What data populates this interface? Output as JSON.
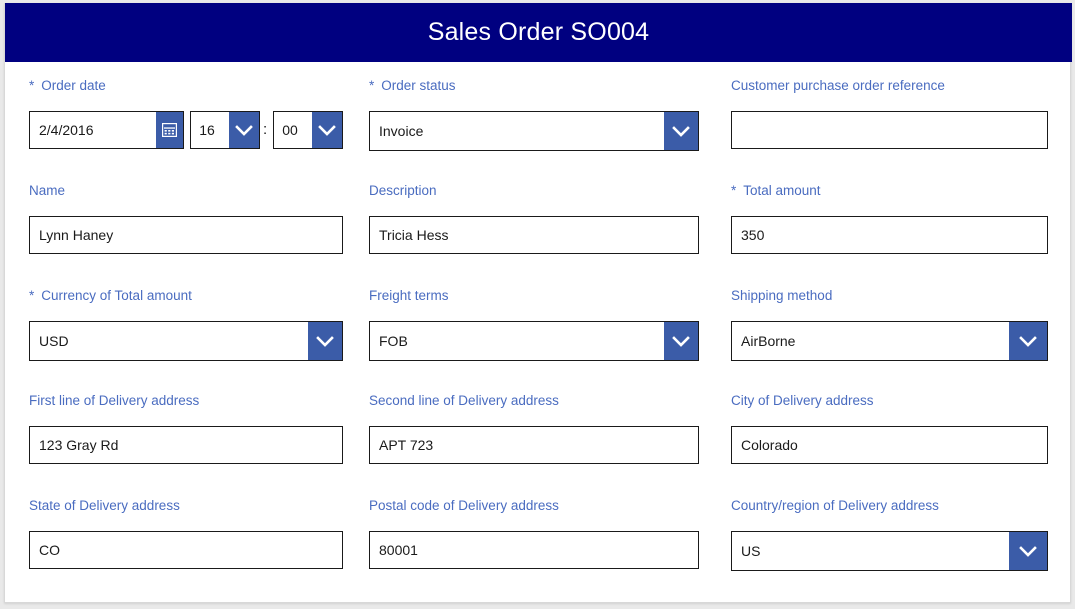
{
  "header": {
    "title": "Sales Order SO004",
    "background_color": "#000080",
    "text_color": "#ffffff"
  },
  "theme": {
    "label_color": "#4a6cc0",
    "accent_button_color": "#3b5ca8",
    "input_border_color": "#1a1a1a",
    "card_background": "#ffffff",
    "page_background": "#e9e9e9"
  },
  "form": {
    "required_marker": "*",
    "time_separator": ":",
    "fields": [
      {
        "name": "order-date",
        "label": "Order date",
        "required": true,
        "type": "datetime",
        "date_value": "2/4/2016",
        "hour_value": "16",
        "minute_value": "00",
        "calendar_icon": "calendar-icon",
        "dropdown_icon": "chevron-down-icon"
      },
      {
        "name": "order-status",
        "label": "Order status",
        "required": true,
        "type": "dropdown",
        "value": "Invoice",
        "dropdown_icon": "chevron-down-icon"
      },
      {
        "name": "customer-purchase-order-reference",
        "label": "Customer purchase order reference",
        "required": false,
        "type": "text",
        "value": "",
        "placeholder": ""
      },
      {
        "name": "name",
        "label": "Name",
        "required": false,
        "type": "text",
        "value": "Lynn Haney",
        "placeholder": ""
      },
      {
        "name": "description",
        "label": "Description",
        "required": false,
        "type": "text",
        "value": "Tricia Hess",
        "placeholder": ""
      },
      {
        "name": "total-amount",
        "label": "Total amount",
        "required": true,
        "type": "text",
        "value": "350",
        "placeholder": ""
      },
      {
        "name": "currency-of-total-amount",
        "label": "Currency of Total amount",
        "required": true,
        "type": "dropdown",
        "value": "USD",
        "dropdown_icon": "chevron-down-icon"
      },
      {
        "name": "freight-terms",
        "label": "Freight terms",
        "required": false,
        "type": "dropdown",
        "value": "FOB",
        "dropdown_icon": "chevron-down-icon"
      },
      {
        "name": "shipping-method",
        "label": "Shipping method",
        "required": false,
        "type": "dropdown",
        "value": "AirBorne",
        "dropdown_icon": "chevron-down-icon"
      },
      {
        "name": "first-line-of-delivery-address",
        "label": "First line of Delivery address",
        "required": false,
        "type": "text",
        "value": "123 Gray Rd",
        "placeholder": ""
      },
      {
        "name": "second-line-of-delivery-address",
        "label": "Second line of Delivery address",
        "required": false,
        "type": "text",
        "value": "APT 723",
        "placeholder": ""
      },
      {
        "name": "city-of-delivery-address",
        "label": "City of Delivery address",
        "required": false,
        "type": "text",
        "value": "Colorado",
        "placeholder": ""
      },
      {
        "name": "state-of-delivery-address",
        "label": "State of Delivery address",
        "required": false,
        "type": "text",
        "value": "CO",
        "placeholder": ""
      },
      {
        "name": "postal-code-of-delivery-address",
        "label": "Postal code of Delivery address",
        "required": false,
        "type": "text",
        "value": "80001",
        "placeholder": ""
      },
      {
        "name": "country-region-of-delivery-address",
        "label": "Country/region of Delivery address",
        "required": false,
        "type": "dropdown",
        "value": "US",
        "dropdown_icon": "chevron-down-icon"
      }
    ]
  }
}
